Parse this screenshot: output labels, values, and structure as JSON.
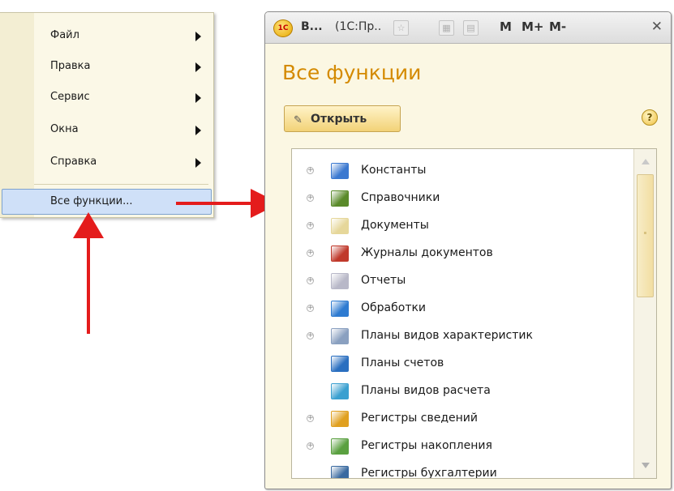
{
  "menu": {
    "items": [
      {
        "label": "Файл",
        "icon": "submenu-arrow-icon"
      },
      {
        "label": "Правка",
        "icon": "submenu-arrow-icon"
      },
      {
        "label": "Сервис",
        "icon": "submenu-arrow-icon"
      },
      {
        "label": "Окна",
        "icon": "submenu-arrow-icon"
      },
      {
        "label": "Справка",
        "icon": "submenu-arrow-icon"
      }
    ],
    "selected_item": {
      "label": "Все функции..."
    }
  },
  "window": {
    "titlebar": {
      "app_short": "В...",
      "app_name": "(1С:Пр..",
      "m_label": "M",
      "m_plus_label": "M+",
      "m_minus_label": "M-",
      "close_glyph": "✕",
      "icons": [
        "app-1c-logo-icon",
        "favorite-icon",
        "calculator-icon",
        "calendar-icon"
      ]
    },
    "title": "Все функции",
    "open_button": {
      "label": "Открыть",
      "icon": "pencil-icon"
    },
    "help_button": {
      "label": "?"
    },
    "tree": {
      "items": [
        {
          "label": "Константы",
          "expandable": true,
          "icon": "constants-icon",
          "color": "#3a78d0"
        },
        {
          "label": "Справочники",
          "expandable": true,
          "icon": "catalogs-icon",
          "color": "#5a8a2a"
        },
        {
          "label": "Документы",
          "expandable": true,
          "icon": "documents-icon",
          "color": "#e6d79a"
        },
        {
          "label": "Журналы документов",
          "expandable": true,
          "icon": "document-journals-icon",
          "color": "#c0392b"
        },
        {
          "label": "Отчеты",
          "expandable": true,
          "icon": "reports-icon",
          "color": "#b8b8c8"
        },
        {
          "label": "Обработки",
          "expandable": true,
          "icon": "data-processors-icon",
          "color": "#2e7bd1"
        },
        {
          "label": "Планы видов характеристик",
          "expandable": true,
          "icon": "characteristic-types-icon",
          "color": "#8aa0c0"
        },
        {
          "label": "Планы счетов",
          "expandable": false,
          "icon": "charts-of-accounts-icon",
          "color": "#2a6fc0"
        },
        {
          "label": "Планы видов расчета",
          "expandable": false,
          "icon": "calculation-types-icon",
          "color": "#3aa0d0"
        },
        {
          "label": "Регистры сведений",
          "expandable": true,
          "icon": "information-registers-icon",
          "color": "#e0a020"
        },
        {
          "label": "Регистры накопления",
          "expandable": true,
          "icon": "accumulation-registers-icon",
          "color": "#5aa040"
        },
        {
          "label": "Регистры бухгалтерии",
          "expandable": false,
          "icon": "accounting-registers-icon",
          "color": "#3a6aa0"
        }
      ]
    }
  },
  "colors": {
    "accent_orange": "#d48a00",
    "annotation_red": "#e41c1c",
    "selection_blue": "#cfe0f8"
  }
}
